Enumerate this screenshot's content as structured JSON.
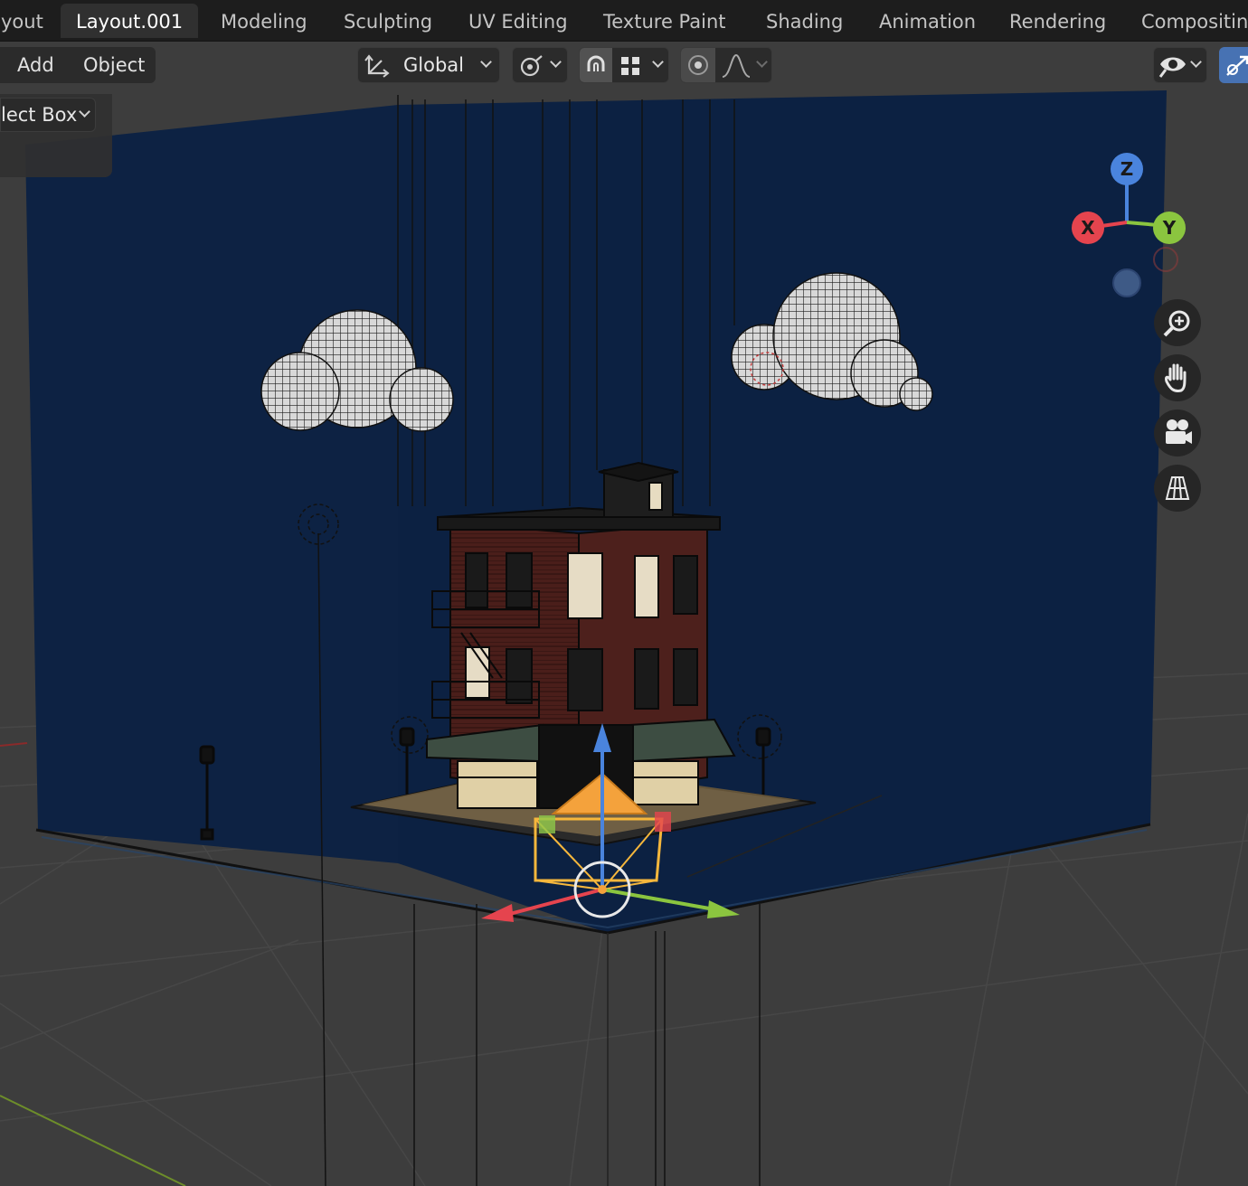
{
  "workspace_tabs": [
    {
      "label": "yout"
    },
    {
      "label": "Layout.001"
    },
    {
      "label": "Modeling"
    },
    {
      "label": "Sculpting"
    },
    {
      "label": "UV Editing"
    },
    {
      "label": "Texture Paint"
    },
    {
      "label": "Shading"
    },
    {
      "label": "Animation"
    },
    {
      "label": "Rendering"
    },
    {
      "label": "Compositin"
    }
  ],
  "header": {
    "menu": [
      "Add",
      "Object"
    ],
    "orientation": "Global",
    "select_mode": "lect Box"
  },
  "gizmo": {
    "z": "Z",
    "x": "X",
    "y": "Y"
  },
  "icons": {
    "orientation": "transform-orientation-icon",
    "pivot": "pivot-point-icon",
    "snap": "snap-magnet-icon",
    "snap_target": "snap-increment-icon",
    "proportional": "proportional-edit-icon",
    "falloff": "falloff-curve-icon",
    "visibility": "eye-visibility-icon",
    "gizmo_toggle": "gizmo-toggle-icon",
    "zoom": "zoom-icon",
    "pan": "hand-icon",
    "camera": "camera-icon",
    "perspective": "grid-perspective-icon"
  },
  "colors": {
    "backdrop": "#0c2142",
    "active_tab": "#303030",
    "axis_x": "#e5444e",
    "axis_y": "#8bc53f",
    "axis_z": "#4a84dd",
    "camera": "#f4a53b",
    "selection": "#f6b73c"
  }
}
